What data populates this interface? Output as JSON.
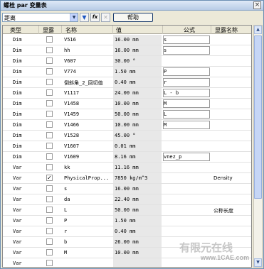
{
  "window": {
    "title": "螺栓 par 变量表",
    "close_glyph": "×"
  },
  "toolbar": {
    "filter_value": "距离",
    "filter_icon": "filter-icon",
    "fx_label": "fx",
    "help_label": "帮助"
  },
  "table": {
    "headers": [
      "类型",
      "显露",
      "名称",
      "值",
      "公式",
      "显露名称"
    ],
    "rows": [
      {
        "type": "Dim",
        "exposed": false,
        "name": "V516",
        "value": "16.00 mm",
        "formula": "s",
        "display_name": ""
      },
      {
        "type": "Dim",
        "exposed": false,
        "name": "hh",
        "value": "16.00 mm",
        "formula": "s",
        "display_name": ""
      },
      {
        "type": "Dim",
        "exposed": false,
        "name": "V607",
        "value": "30.00 °",
        "formula": "",
        "display_name": ""
      },
      {
        "type": "Dim",
        "exposed": false,
        "name": "V774",
        "value": "1.50 mm",
        "formula": "P",
        "display_name": ""
      },
      {
        "type": "Dim",
        "exposed": false,
        "name": "倒斜角_2_回切值",
        "value": "0.40 mm",
        "formula": "r",
        "display_name": ""
      },
      {
        "type": "Dim",
        "exposed": false,
        "name": "V1117",
        "value": "24.00 mm",
        "formula": "L - b",
        "display_name": ""
      },
      {
        "type": "Dim",
        "exposed": false,
        "name": "V1458",
        "value": "10.00 mm",
        "formula": "M",
        "display_name": ""
      },
      {
        "type": "Dim",
        "exposed": false,
        "name": "V1459",
        "value": "50.00 mm",
        "formula": "L",
        "display_name": ""
      },
      {
        "type": "Dim",
        "exposed": false,
        "name": "V1466",
        "value": "10.00 mm",
        "formula": "M",
        "display_name": ""
      },
      {
        "type": "Dim",
        "exposed": false,
        "name": "V1528",
        "value": "45.00 °",
        "formula": "",
        "display_name": ""
      },
      {
        "type": "Dim",
        "exposed": false,
        "name": "V1607",
        "value": "0.01 mm",
        "formula": "",
        "display_name": ""
      },
      {
        "type": "Dim",
        "exposed": false,
        "name": "V1609",
        "value": "8.16 mm",
        "formula": "vnez_p",
        "display_name": ""
      },
      {
        "type": "Var",
        "exposed": false,
        "name": "kk",
        "value": "11.16 mm",
        "formula": "",
        "display_name": ""
      },
      {
        "type": "Var",
        "exposed": true,
        "name": "PhysicalProp...",
        "value": "7850 kg/m^3",
        "formula": "",
        "display_name": "Density"
      },
      {
        "type": "Var",
        "exposed": false,
        "name": "s",
        "value": "16.00 mm",
        "formula": "",
        "display_name": ""
      },
      {
        "type": "Var",
        "exposed": false,
        "name": "da",
        "value": "22.40 mm",
        "formula": "",
        "display_name": ""
      },
      {
        "type": "Var",
        "exposed": false,
        "name": "L",
        "value": "50.00 mm",
        "formula": "",
        "display_name": "公称长度"
      },
      {
        "type": "Var",
        "exposed": false,
        "name": "P",
        "value": "1.50 mm",
        "formula": "",
        "display_name": ""
      },
      {
        "type": "Var",
        "exposed": false,
        "name": "r",
        "value": "0.40 mm",
        "formula": "",
        "display_name": ""
      },
      {
        "type": "Var",
        "exposed": false,
        "name": "b",
        "value": "26.00 mm",
        "formula": "",
        "display_name": ""
      },
      {
        "type": "Var",
        "exposed": false,
        "name": "M",
        "value": "10.00 mm",
        "formula": "",
        "display_name": ""
      },
      {
        "type": "Var",
        "exposed": false,
        "name": "",
        "value": "",
        "formula": "",
        "display_name": ""
      }
    ]
  },
  "watermark": {
    "text": "有限元在线",
    "url": "www.1CAE.com"
  },
  "colors": {
    "title_bar": "#b7cbe6",
    "grid_background": "#ffffff",
    "value_cell": "#e8e8e8"
  }
}
